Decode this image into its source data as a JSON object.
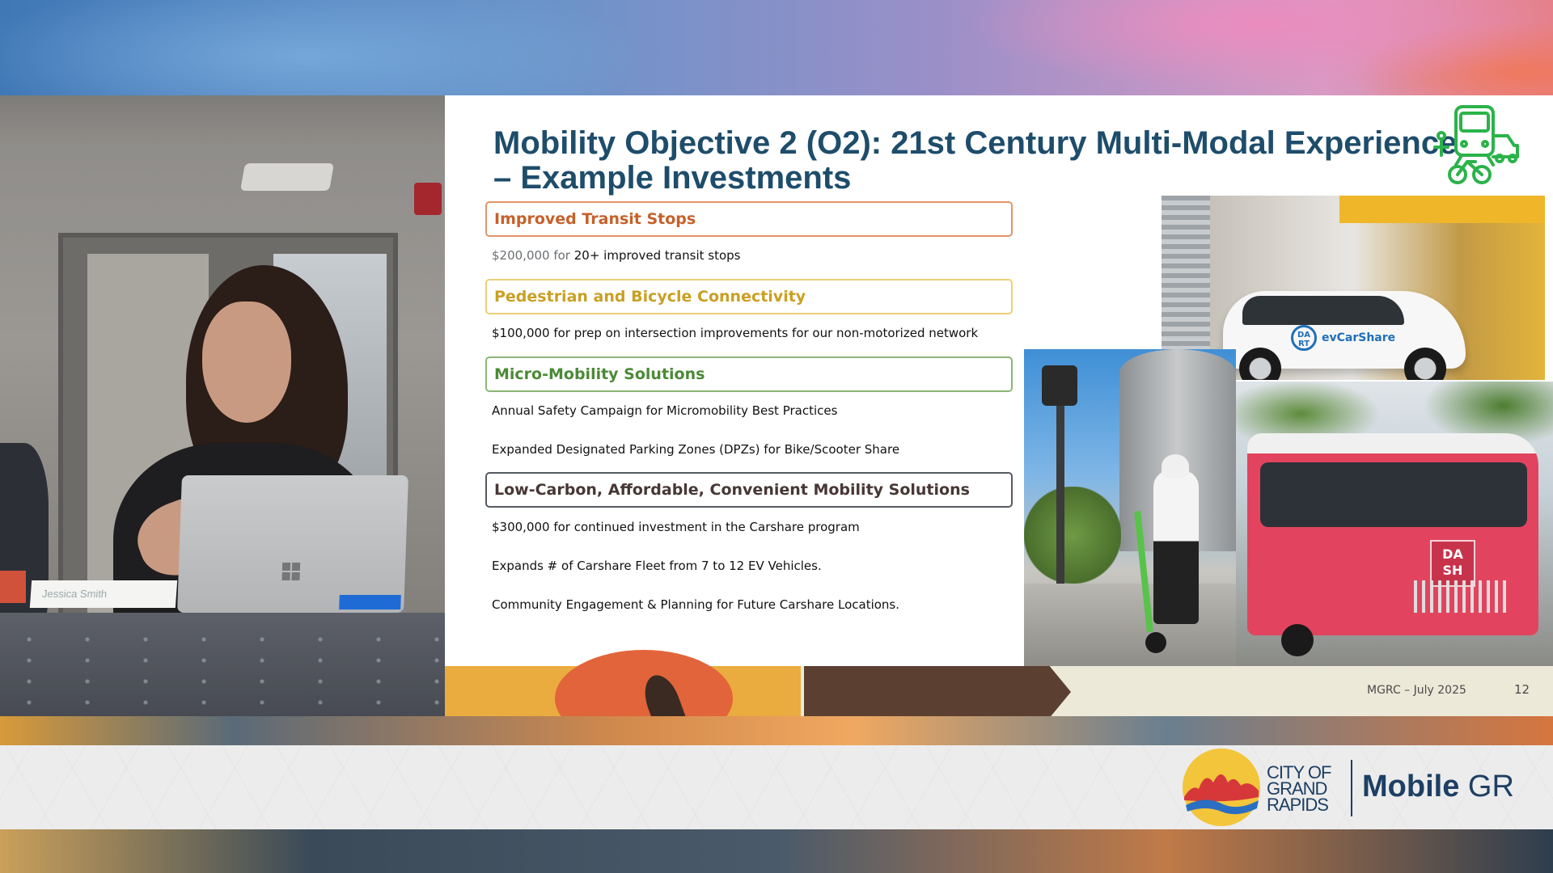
{
  "slide": {
    "title_line1": "Mobility Objective 2 (O2): 21st Century Multi-Modal Experience",
    "title_line2": "– Example Investments",
    "sections": [
      {
        "heading": "Improved Transit Stops",
        "color": "#c5612b",
        "items": [
          {
            "amount": "$200,000 for",
            "text": "20+ improved transit stops"
          }
        ]
      },
      {
        "heading": "Pedestrian and Bicycle Connectivity",
        "color": "#c9a023",
        "items": [
          {
            "text": "$100,000 for prep on intersection improvements for our non-motorized network"
          }
        ]
      },
      {
        "heading": "Micro-Mobility Solutions",
        "color": "#4b8a36",
        "items": [
          {
            "text": "Annual Safety Campaign for Micromobility Best Practices"
          },
          {
            "text": "Expanded Designated Parking Zones (DPZs) for Bike/Scooter Share"
          }
        ]
      },
      {
        "heading": "Low-Carbon, Affordable, Convenient Mobility Solutions",
        "color": "#473734",
        "items": [
          {
            "text": "$300,000 for continued investment in the Carshare program"
          },
          {
            "text": "Expands # of Carshare Fleet from 7 to 12 EV Vehicles."
          },
          {
            "text": "Community Engagement & Planning for Future Carshare Locations."
          }
        ]
      }
    ],
    "photos": {
      "car_brand": "evCarShare",
      "car_badge": "DA RT",
      "bus_sign": "DA SH"
    },
    "footer_text": "MGRC – July 2025",
    "page_number": "12",
    "icon_name": "multimodal-transport-icon",
    "accent_color": "#1e4d6b"
  },
  "camera": {
    "nameplate": "Jessica Smith"
  },
  "branding": {
    "city_line1": "CITY OF",
    "city_line2": "GRAND",
    "city_line3": "RAPIDS",
    "product_bold": "Mobile",
    "product_rest": " GR"
  }
}
